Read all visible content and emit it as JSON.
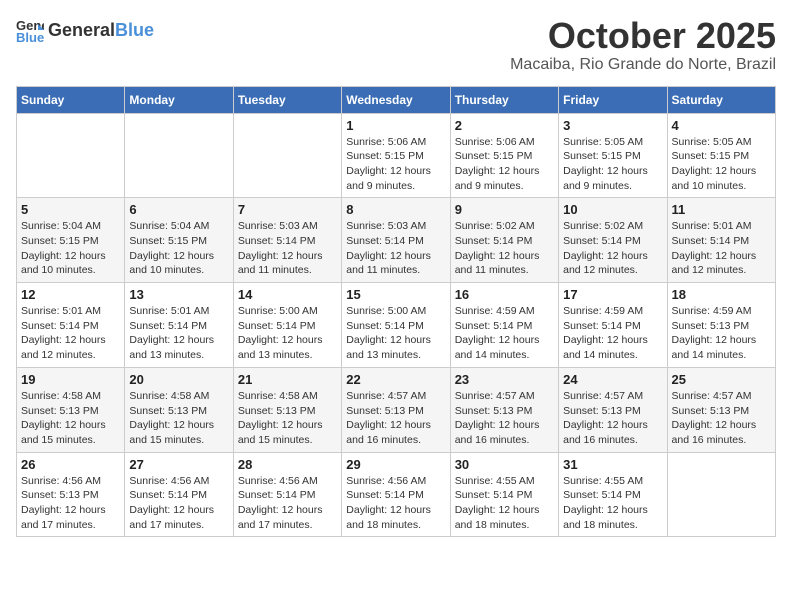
{
  "header": {
    "logo_general": "General",
    "logo_blue": "Blue",
    "month": "October 2025",
    "location": "Macaiba, Rio Grande do Norte, Brazil"
  },
  "weekdays": [
    "Sunday",
    "Monday",
    "Tuesday",
    "Wednesday",
    "Thursday",
    "Friday",
    "Saturday"
  ],
  "weeks": [
    [
      {
        "day": "",
        "sunrise": "",
        "sunset": "",
        "daylight": ""
      },
      {
        "day": "",
        "sunrise": "",
        "sunset": "",
        "daylight": ""
      },
      {
        "day": "",
        "sunrise": "",
        "sunset": "",
        "daylight": ""
      },
      {
        "day": "1",
        "sunrise": "Sunrise: 5:06 AM",
        "sunset": "Sunset: 5:15 PM",
        "daylight": "Daylight: 12 hours and 9 minutes."
      },
      {
        "day": "2",
        "sunrise": "Sunrise: 5:06 AM",
        "sunset": "Sunset: 5:15 PM",
        "daylight": "Daylight: 12 hours and 9 minutes."
      },
      {
        "day": "3",
        "sunrise": "Sunrise: 5:05 AM",
        "sunset": "Sunset: 5:15 PM",
        "daylight": "Daylight: 12 hours and 9 minutes."
      },
      {
        "day": "4",
        "sunrise": "Sunrise: 5:05 AM",
        "sunset": "Sunset: 5:15 PM",
        "daylight": "Daylight: 12 hours and 10 minutes."
      }
    ],
    [
      {
        "day": "5",
        "sunrise": "Sunrise: 5:04 AM",
        "sunset": "Sunset: 5:15 PM",
        "daylight": "Daylight: 12 hours and 10 minutes."
      },
      {
        "day": "6",
        "sunrise": "Sunrise: 5:04 AM",
        "sunset": "Sunset: 5:15 PM",
        "daylight": "Daylight: 12 hours and 10 minutes."
      },
      {
        "day": "7",
        "sunrise": "Sunrise: 5:03 AM",
        "sunset": "Sunset: 5:14 PM",
        "daylight": "Daylight: 12 hours and 11 minutes."
      },
      {
        "day": "8",
        "sunrise": "Sunrise: 5:03 AM",
        "sunset": "Sunset: 5:14 PM",
        "daylight": "Daylight: 12 hours and 11 minutes."
      },
      {
        "day": "9",
        "sunrise": "Sunrise: 5:02 AM",
        "sunset": "Sunset: 5:14 PM",
        "daylight": "Daylight: 12 hours and 11 minutes."
      },
      {
        "day": "10",
        "sunrise": "Sunrise: 5:02 AM",
        "sunset": "Sunset: 5:14 PM",
        "daylight": "Daylight: 12 hours and 12 minutes."
      },
      {
        "day": "11",
        "sunrise": "Sunrise: 5:01 AM",
        "sunset": "Sunset: 5:14 PM",
        "daylight": "Daylight: 12 hours and 12 minutes."
      }
    ],
    [
      {
        "day": "12",
        "sunrise": "Sunrise: 5:01 AM",
        "sunset": "Sunset: 5:14 PM",
        "daylight": "Daylight: 12 hours and 12 minutes."
      },
      {
        "day": "13",
        "sunrise": "Sunrise: 5:01 AM",
        "sunset": "Sunset: 5:14 PM",
        "daylight": "Daylight: 12 hours and 13 minutes."
      },
      {
        "day": "14",
        "sunrise": "Sunrise: 5:00 AM",
        "sunset": "Sunset: 5:14 PM",
        "daylight": "Daylight: 12 hours and 13 minutes."
      },
      {
        "day": "15",
        "sunrise": "Sunrise: 5:00 AM",
        "sunset": "Sunset: 5:14 PM",
        "daylight": "Daylight: 12 hours and 13 minutes."
      },
      {
        "day": "16",
        "sunrise": "Sunrise: 4:59 AM",
        "sunset": "Sunset: 5:14 PM",
        "daylight": "Daylight: 12 hours and 14 minutes."
      },
      {
        "day": "17",
        "sunrise": "Sunrise: 4:59 AM",
        "sunset": "Sunset: 5:14 PM",
        "daylight": "Daylight: 12 hours and 14 minutes."
      },
      {
        "day": "18",
        "sunrise": "Sunrise: 4:59 AM",
        "sunset": "Sunset: 5:13 PM",
        "daylight": "Daylight: 12 hours and 14 minutes."
      }
    ],
    [
      {
        "day": "19",
        "sunrise": "Sunrise: 4:58 AM",
        "sunset": "Sunset: 5:13 PM",
        "daylight": "Daylight: 12 hours and 15 minutes."
      },
      {
        "day": "20",
        "sunrise": "Sunrise: 4:58 AM",
        "sunset": "Sunset: 5:13 PM",
        "daylight": "Daylight: 12 hours and 15 minutes."
      },
      {
        "day": "21",
        "sunrise": "Sunrise: 4:58 AM",
        "sunset": "Sunset: 5:13 PM",
        "daylight": "Daylight: 12 hours and 15 minutes."
      },
      {
        "day": "22",
        "sunrise": "Sunrise: 4:57 AM",
        "sunset": "Sunset: 5:13 PM",
        "daylight": "Daylight: 12 hours and 16 minutes."
      },
      {
        "day": "23",
        "sunrise": "Sunrise: 4:57 AM",
        "sunset": "Sunset: 5:13 PM",
        "daylight": "Daylight: 12 hours and 16 minutes."
      },
      {
        "day": "24",
        "sunrise": "Sunrise: 4:57 AM",
        "sunset": "Sunset: 5:13 PM",
        "daylight": "Daylight: 12 hours and 16 minutes."
      },
      {
        "day": "25",
        "sunrise": "Sunrise: 4:57 AM",
        "sunset": "Sunset: 5:13 PM",
        "daylight": "Daylight: 12 hours and 16 minutes."
      }
    ],
    [
      {
        "day": "26",
        "sunrise": "Sunrise: 4:56 AM",
        "sunset": "Sunset: 5:13 PM",
        "daylight": "Daylight: 12 hours and 17 minutes."
      },
      {
        "day": "27",
        "sunrise": "Sunrise: 4:56 AM",
        "sunset": "Sunset: 5:14 PM",
        "daylight": "Daylight: 12 hours and 17 minutes."
      },
      {
        "day": "28",
        "sunrise": "Sunrise: 4:56 AM",
        "sunset": "Sunset: 5:14 PM",
        "daylight": "Daylight: 12 hours and 17 minutes."
      },
      {
        "day": "29",
        "sunrise": "Sunrise: 4:56 AM",
        "sunset": "Sunset: 5:14 PM",
        "daylight": "Daylight: 12 hours and 18 minutes."
      },
      {
        "day": "30",
        "sunrise": "Sunrise: 4:55 AM",
        "sunset": "Sunset: 5:14 PM",
        "daylight": "Daylight: 12 hours and 18 minutes."
      },
      {
        "day": "31",
        "sunrise": "Sunrise: 4:55 AM",
        "sunset": "Sunset: 5:14 PM",
        "daylight": "Daylight: 12 hours and 18 minutes."
      },
      {
        "day": "",
        "sunrise": "",
        "sunset": "",
        "daylight": ""
      }
    ]
  ]
}
